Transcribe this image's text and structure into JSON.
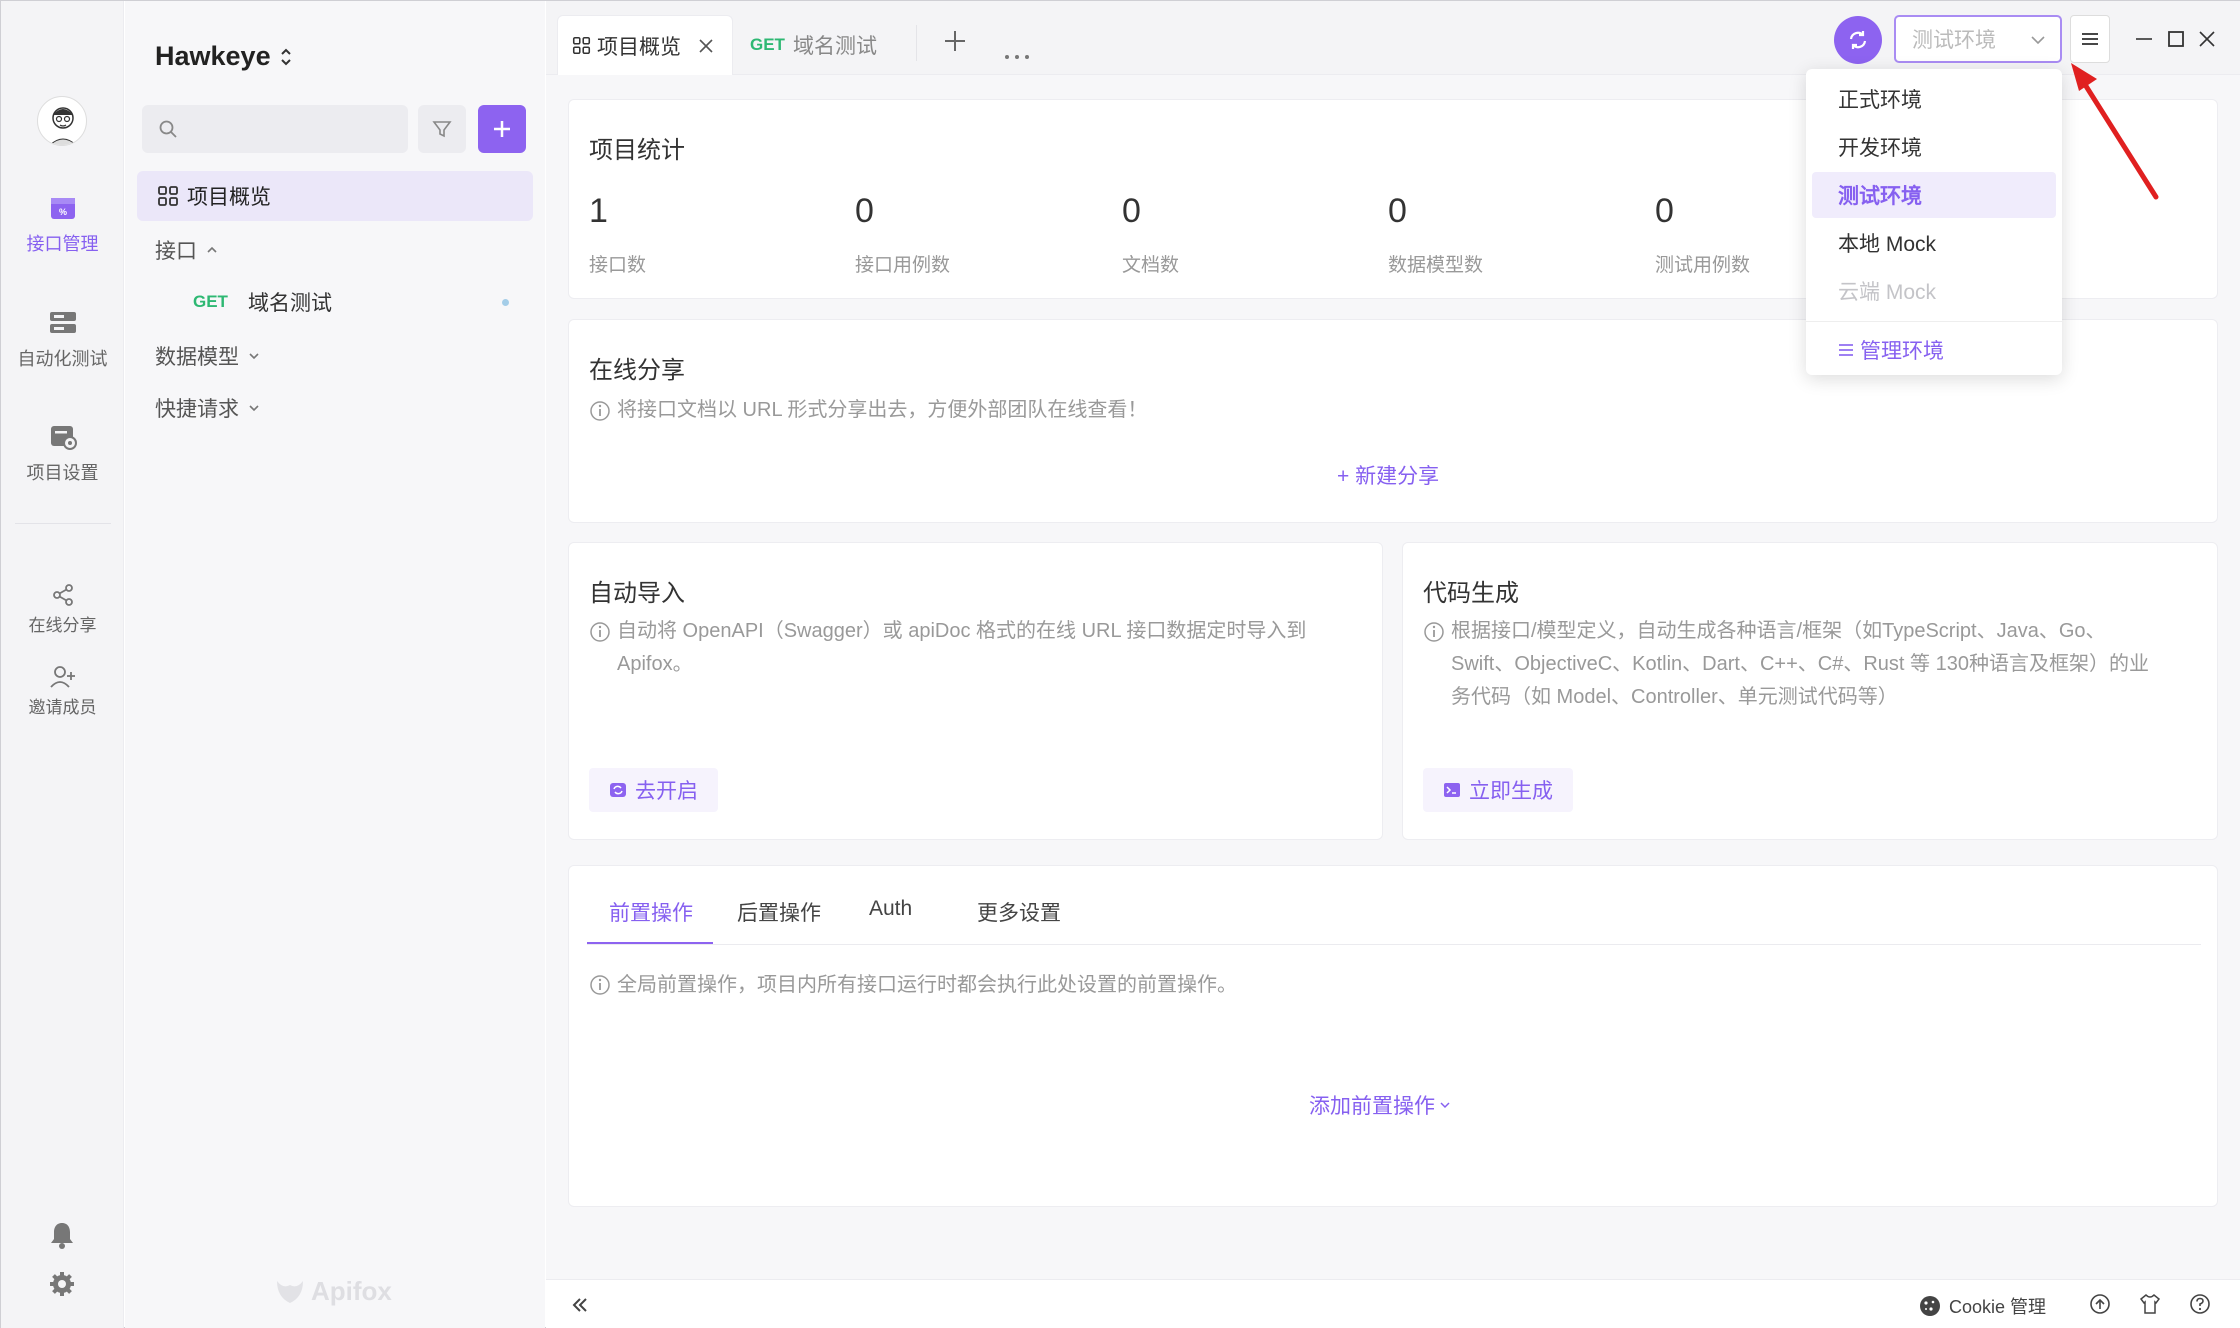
{
  "sidebar": {
    "items": [
      {
        "label": "接口管理"
      },
      {
        "label": "自动化测试"
      },
      {
        "label": "项目设置"
      },
      {
        "label": "在线分享"
      },
      {
        "label": "邀请成员"
      }
    ]
  },
  "tree": {
    "project_name": "Hawkeye",
    "overview_label": "项目概览",
    "api_group": "接口",
    "api_method": "GET",
    "api_name": "域名测试",
    "models_group": "数据模型",
    "quick_group": "快捷请求",
    "brand": "Apifox"
  },
  "tabs": [
    {
      "label": "项目概览"
    },
    {
      "method": "GET",
      "label": "域名测试"
    }
  ],
  "stats": {
    "title": "项目统计",
    "items": [
      {
        "value": "1",
        "label": "接口数"
      },
      {
        "value": "0",
        "label": "接口用例数"
      },
      {
        "value": "0",
        "label": "文档数"
      },
      {
        "value": "0",
        "label": "数据模型数"
      },
      {
        "value": "0",
        "label": "测试用例数"
      }
    ]
  },
  "share": {
    "title": "在线分享",
    "desc": "将接口文档以 URL 形式分享出去，方便外部团队在线查看！",
    "action": "+ 新建分享"
  },
  "auto_import": {
    "title": "自动导入",
    "desc_line1": "自动将 OpenAPI（Swagger）或 apiDoc 格式的在线 URL 接口数据定时导入到",
    "desc_line2": "Apifox。",
    "action": "去开启"
  },
  "codegen": {
    "title": "代码生成",
    "desc_line1": "根据接口/模型定义，自动生成各种语言/框架（如TypeScript、Java、Go、",
    "desc_line2": "Swift、ObjectiveC、Kotlin、Dart、C++、C#、Rust 等 130种语言及框架）的业",
    "desc_line3": "务代码（如 Model、Controller、单元测试代码等）",
    "action": "立即生成"
  },
  "pre_ops": {
    "tabs": [
      "前置操作",
      "后置操作",
      "Auth",
      "更多设置"
    ],
    "desc": "全局前置操作，项目内所有接口运行时都会执行此处设置的前置操作。",
    "action": "添加前置操作"
  },
  "env": {
    "selected": "测试环境",
    "options": [
      "正式环境",
      "开发环境",
      "测试环境",
      "本地 Mock",
      "云端 Mock"
    ],
    "manage": "管理环境"
  },
  "status": {
    "cookie": "Cookie 管理"
  },
  "colors": {
    "accent": "#8d63f0",
    "get": "#2eb873",
    "arrow": "#e02020"
  }
}
